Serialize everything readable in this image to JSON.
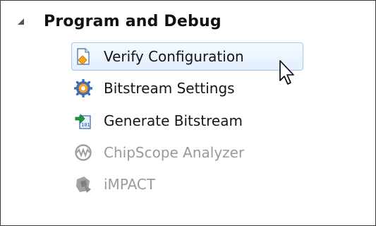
{
  "tree": {
    "group": {
      "title": "Program and Debug",
      "expander_icon": "triangle-expanded-icon"
    },
    "items": [
      {
        "label": "Verify Configuration",
        "icon": "document-verify-icon",
        "state": "selected-hover"
      },
      {
        "label": "Bitstream Settings",
        "icon": "gear-settings-icon",
        "state": "normal"
      },
      {
        "label": "Generate Bitstream",
        "icon": "binary-file-arrow-icon",
        "state": "normal"
      },
      {
        "label": "ChipScope Analyzer",
        "icon": "chipscope-waveform-icon",
        "state": "disabled"
      },
      {
        "label": "iMPACT",
        "icon": "impact-tool-icon",
        "state": "disabled"
      }
    ]
  },
  "colors": {
    "selection_border": "#a9c6e8",
    "selection_fill": "#e3efff",
    "disabled_text": "#9a9a9a",
    "normal_text": "#161616"
  }
}
